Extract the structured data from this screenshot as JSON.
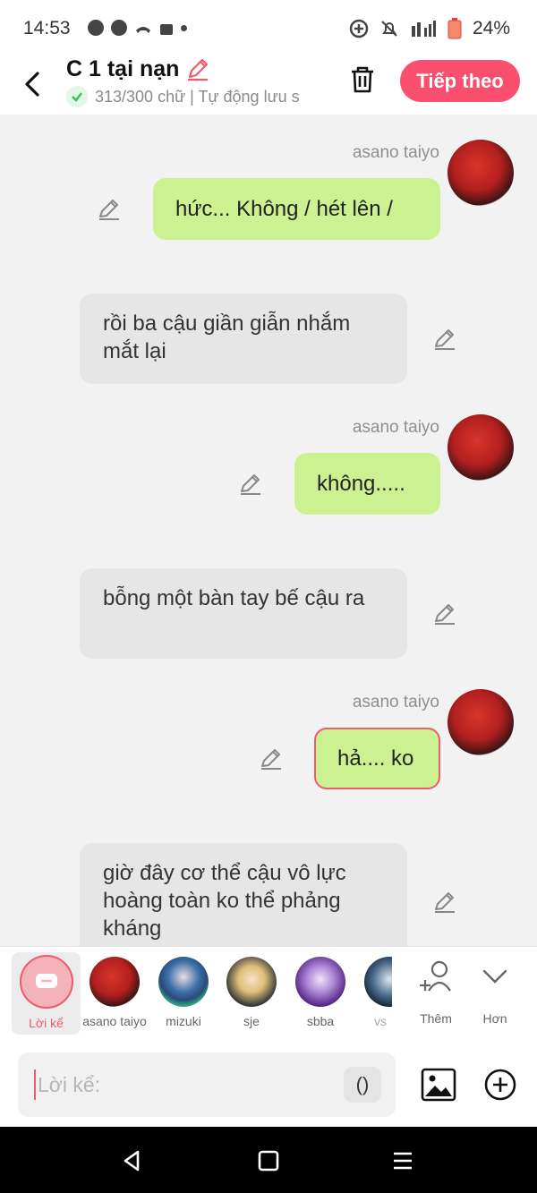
{
  "status_bar": {
    "time": "14:53",
    "battery": "24%",
    "icons_left": [
      "messenger-icon",
      "messenger-icon",
      "missed-call-icon",
      "shop-icon",
      "dot-icon"
    ],
    "icons_right": [
      "sync-icon",
      "mute-icon",
      "lte-icon",
      "signal-icon",
      "battery-icon"
    ]
  },
  "header": {
    "title": "C 1 tại nạn",
    "subtitle": "313/300 chữ | Tự động lưu s",
    "next_label": "Tiếp theo"
  },
  "messages": [
    {
      "type": "character",
      "sender": "asano taiyo",
      "text": "hức... Không / hét lên /"
    },
    {
      "type": "narration",
      "text": "rồi ba cậu giần giẫn nhắm mắt lại"
    },
    {
      "type": "character",
      "sender": "asano taiyo",
      "text": "không....."
    },
    {
      "type": "narration",
      "text": "bỗng một bàn tay bế cậu ra"
    },
    {
      "type": "character",
      "sender": "asano taiyo",
      "text": "hả.... ko"
    },
    {
      "type": "narration",
      "text": "giờ đây cơ thể cậu vô lực hoàng toàn ko thể phảng kháng"
    }
  ],
  "characters": [
    {
      "name": "Lời kể",
      "selected": true
    },
    {
      "name": "asano taiyo"
    },
    {
      "name": "mizuki"
    },
    {
      "name": "sje"
    },
    {
      "name": "sbba"
    },
    {
      "name": "vs"
    }
  ],
  "char_actions": {
    "more_label": "Thêm",
    "collapse_label": "Hơn"
  },
  "input": {
    "placeholder": "Lời kể:",
    "paren_label": "()"
  },
  "colors": {
    "accent": "#fb4f70",
    "bubble_green": "#ccf190",
    "bubble_gray": "#e6e6e6"
  }
}
